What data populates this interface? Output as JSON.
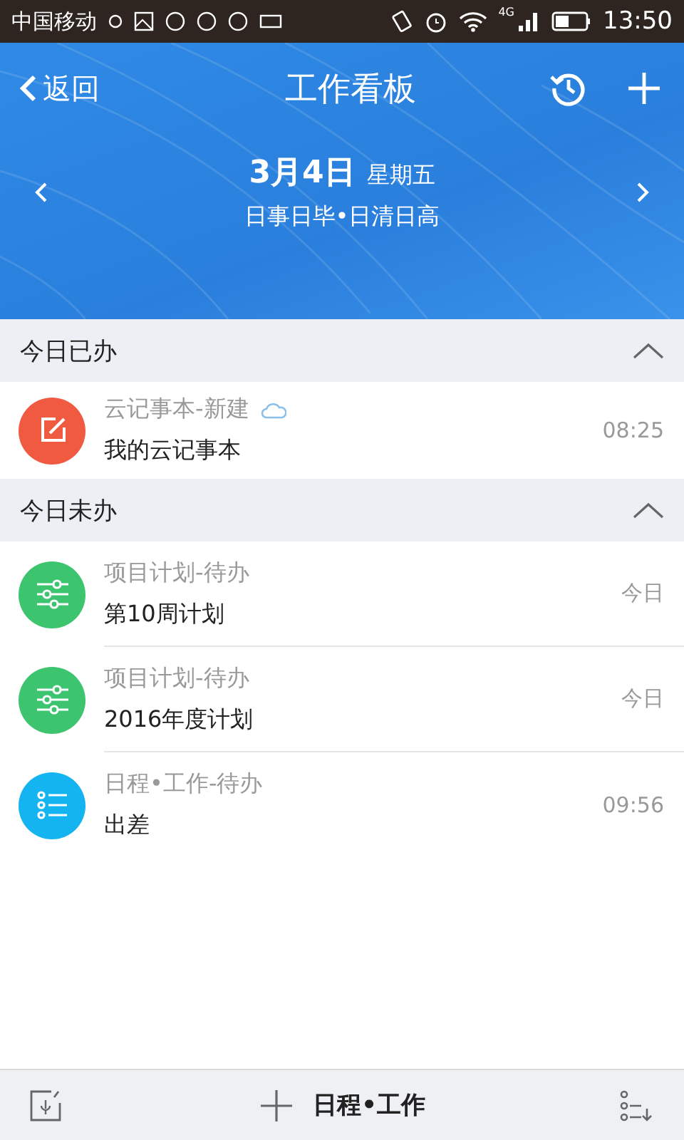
{
  "status_bar": {
    "carrier": "中国移动",
    "time": "13:50",
    "network": "4G"
  },
  "header": {
    "back": "返回",
    "title": "工作看板",
    "date": "3月4日",
    "weekday": "星期五",
    "motto": "日事日毕•日清日高"
  },
  "sections": [
    {
      "title": "今日已办",
      "expanded": true,
      "items": [
        {
          "kind": "note",
          "category": "云记事本-新建",
          "cloud": true,
          "title": "我的云记事本",
          "time": "08:25",
          "color": "#f05a40"
        }
      ]
    },
    {
      "title": "今日未办",
      "expanded": true,
      "items": [
        {
          "kind": "plan",
          "category": "项目计划-待办",
          "cloud": false,
          "title": "第10周计划",
          "time": "今日",
          "color": "#3cc46e"
        },
        {
          "kind": "plan",
          "category": "项目计划-待办",
          "cloud": false,
          "title": "2016年度计划",
          "time": "今日",
          "color": "#3cc46e"
        },
        {
          "kind": "schedule",
          "category": "日程•工作-待办",
          "cloud": false,
          "title": "出差",
          "time": "09:56",
          "color": "#14b4f0"
        }
      ]
    }
  ],
  "bottom_bar": {
    "label": "日程•工作"
  }
}
